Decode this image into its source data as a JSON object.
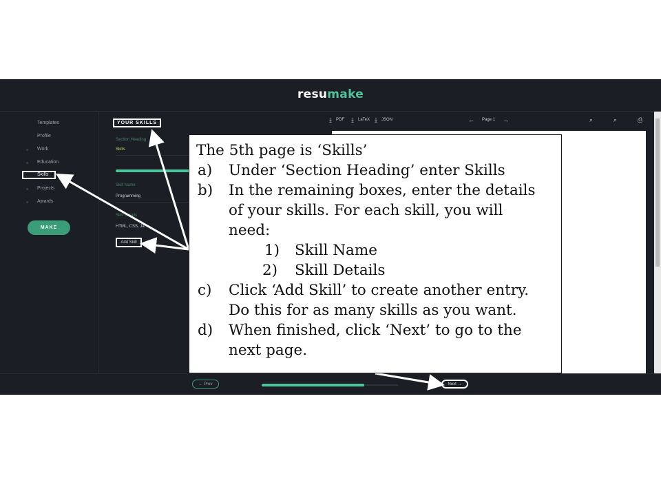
{
  "app": {
    "logo_part1": "resu",
    "logo_part2": "make",
    "brand_color": "#4fc39a"
  },
  "sidebar": {
    "items": [
      {
        "label": "Templates"
      },
      {
        "label": "Profile"
      },
      {
        "label": "Work"
      },
      {
        "label": "Education"
      },
      {
        "label": "Skills",
        "active": true
      },
      {
        "label": "Projects"
      },
      {
        "label": "Awards"
      }
    ],
    "make_label": "MAKE"
  },
  "form": {
    "title": "YOUR SKILLS",
    "section_heading_label": "Section Heading",
    "section_heading_value": "Skills",
    "skill_name_label": "Skill Name",
    "skill_name_value": "Programming",
    "skill_details_label": "Skill Details",
    "skill_details_value": "HTML, CSS, Ja",
    "add_skill_label": "Add Skill"
  },
  "preview_toolbar": {
    "pdf_label": "PDF",
    "latex_label": "LaTeX",
    "json_label": "JSON",
    "page_label": "Page 1",
    "icons": [
      "download-icon",
      "arrow-left-icon",
      "arrow-right-icon",
      "zoom-in-icon",
      "zoom-out-icon",
      "print-icon"
    ]
  },
  "footer": {
    "prev_label": "← Prev",
    "next_label": "Next →",
    "progress_fraction": 0.75
  },
  "callout": {
    "lines": [
      "The 5th page is ‘Skills’",
      "a)",
      "Under ‘Section Heading’ enter Skills",
      "b)",
      "In the remaining boxes, enter the details",
      "of your skills. For each skill, you will",
      "need:",
      "1)",
      "Skill Name",
      "2)",
      "Skill Details",
      "c)",
      "Click ‘Add Skill’ to create another entry.",
      "Do this for as many skills as you want.",
      "d)",
      "When finished, click ‘Next’ to go to the",
      "next page."
    ]
  }
}
